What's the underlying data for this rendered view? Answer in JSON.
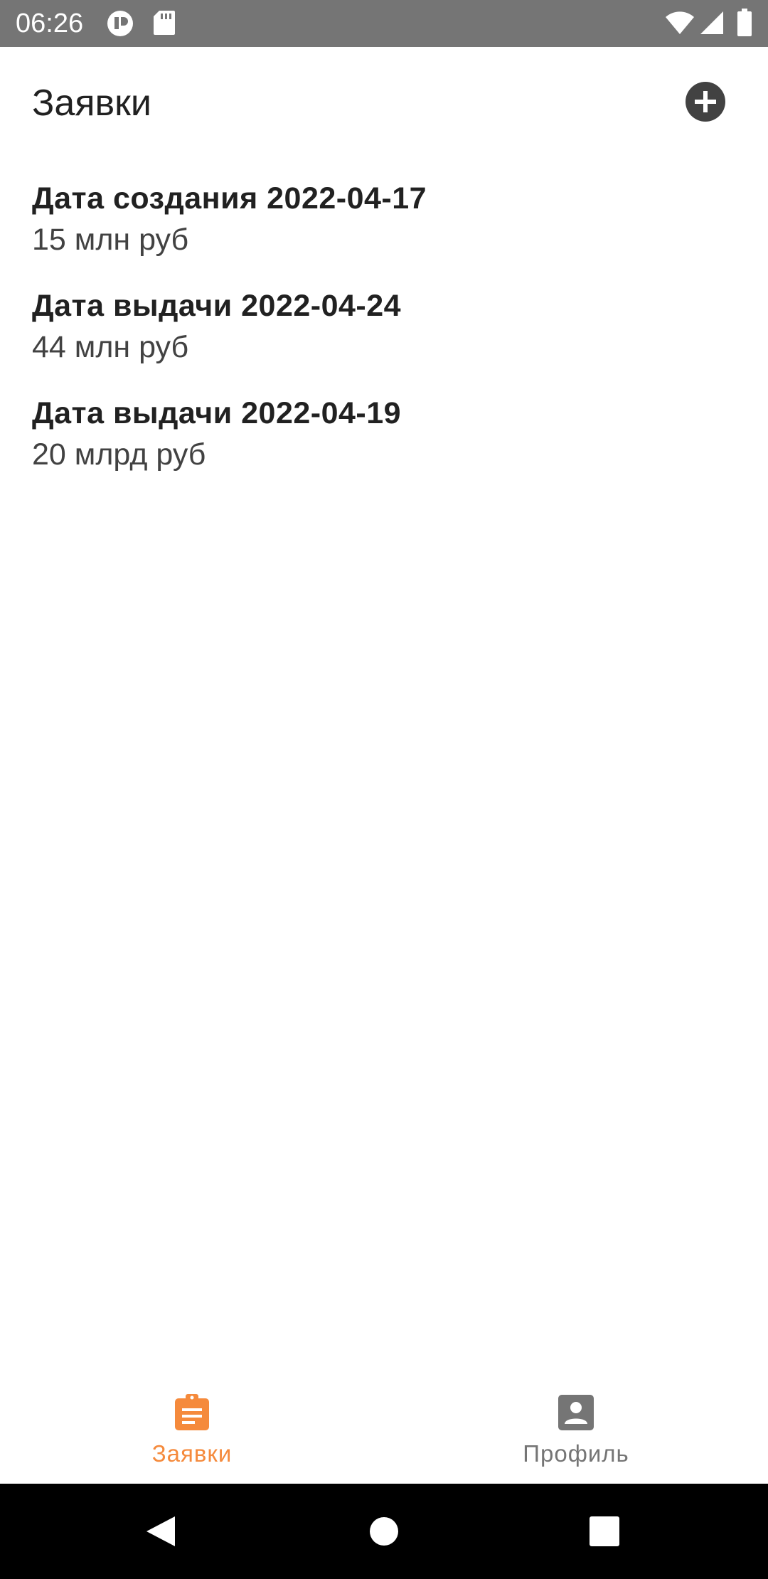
{
  "status_bar": {
    "time": "06:26",
    "icons": [
      "shield-icon",
      "sd-card-icon",
      "wifi-icon",
      "signal-icon",
      "battery-icon"
    ]
  },
  "header": {
    "title": "Заявки",
    "add_icon": "add-circle-icon"
  },
  "requests": [
    {
      "title": "Дата создания 2022-04-17",
      "amount": "15 млн руб"
    },
    {
      "title": "Дата выдачи 2022-04-24",
      "amount": "44 млн руб"
    },
    {
      "title": "Дата выдачи 2022-04-19",
      "amount": "20 млрд руб"
    }
  ],
  "bottom_nav": {
    "items": [
      {
        "label": "Заявки",
        "icon": "clipboard-icon",
        "active": true
      },
      {
        "label": "Профиль",
        "icon": "profile-card-icon",
        "active": false
      }
    ]
  },
  "system_nav": {
    "buttons": [
      "back-icon",
      "home-icon",
      "recents-icon"
    ]
  },
  "colors": {
    "status_bar": "#757575",
    "accent": "#F58A3C",
    "inactive": "#757575",
    "title_text": "#212121",
    "system_nav": "#000000"
  }
}
